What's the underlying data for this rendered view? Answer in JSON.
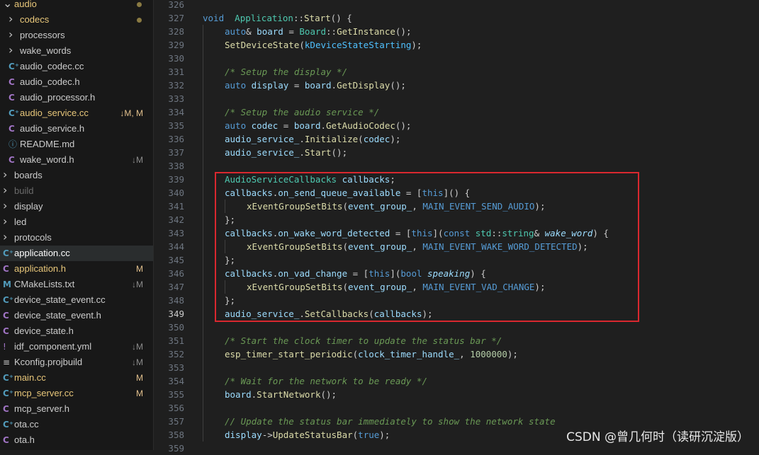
{
  "sidebar": {
    "items": [
      {
        "icon": "chevron-down",
        "name": "audio",
        "depth": 0,
        "color": "#e8c77a",
        "status": "",
        "dot": true
      },
      {
        "icon": "chevron-right",
        "name": "codecs",
        "depth": 1,
        "color": "#e8c77a",
        "status": "",
        "dot": true
      },
      {
        "icon": "chevron-right",
        "name": "processors",
        "depth": 1,
        "color": "#cccccc",
        "status": ""
      },
      {
        "icon": "chevron-right",
        "name": "wake_words",
        "depth": 1,
        "color": "#cccccc",
        "status": ""
      },
      {
        "icon": "cpp-file",
        "name": "audio_codec.cc",
        "depth": 1,
        "color": "#cccccc",
        "status": ""
      },
      {
        "icon": "c-file",
        "name": "audio_codec.h",
        "depth": 1,
        "color": "#cccccc",
        "status": ""
      },
      {
        "icon": "c-file",
        "name": "audio_processor.h",
        "depth": 1,
        "color": "#cccccc",
        "status": ""
      },
      {
        "icon": "cpp-file",
        "name": "audio_service.cc",
        "depth": 1,
        "color": "#e8c77a",
        "status": "↓M, M",
        "statusColor": "#e2c08d"
      },
      {
        "icon": "c-file",
        "name": "audio_service.h",
        "depth": 1,
        "color": "#cccccc",
        "status": ""
      },
      {
        "icon": "info-file",
        "name": "README.md",
        "depth": 1,
        "color": "#cccccc",
        "status": ""
      },
      {
        "icon": "c-file",
        "name": "wake_word.h",
        "depth": 1,
        "color": "#cccccc",
        "status": "↓M",
        "statusColor": "#8b8b8b"
      },
      {
        "icon": "chevron-right",
        "name": "boards",
        "depth": 0,
        "color": "#cccccc",
        "status": ""
      },
      {
        "icon": "chevron-right",
        "name": "build",
        "depth": 0,
        "color": "#6b6b6b",
        "status": ""
      },
      {
        "icon": "chevron-right",
        "name": "display",
        "depth": 0,
        "color": "#cccccc",
        "status": ""
      },
      {
        "icon": "chevron-right",
        "name": "led",
        "depth": 0,
        "color": "#cccccc",
        "status": ""
      },
      {
        "icon": "chevron-right",
        "name": "protocols",
        "depth": 0,
        "color": "#cccccc",
        "status": ""
      },
      {
        "icon": "cpp-file",
        "name": "application.cc",
        "depth": 0,
        "color": "#ffffff",
        "status": "",
        "selected": true
      },
      {
        "icon": "c-file",
        "name": "application.h",
        "depth": 0,
        "color": "#e8c77a",
        "status": "M",
        "statusColor": "#e2c08d"
      },
      {
        "icon": "m-file",
        "name": "CMakeLists.txt",
        "depth": 0,
        "color": "#cccccc",
        "status": "↓M",
        "statusColor": "#8b8b8b"
      },
      {
        "icon": "cpp-file",
        "name": "device_state_event.cc",
        "depth": 0,
        "color": "#cccccc",
        "status": ""
      },
      {
        "icon": "c-file",
        "name": "device_state_event.h",
        "depth": 0,
        "color": "#cccccc",
        "status": ""
      },
      {
        "icon": "c-file",
        "name": "device_state.h",
        "depth": 0,
        "color": "#cccccc",
        "status": ""
      },
      {
        "icon": "yml-file",
        "name": "idf_component.yml",
        "depth": 0,
        "color": "#cccccc",
        "status": "↓M",
        "statusColor": "#8b8b8b"
      },
      {
        "icon": "lines-file",
        "name": "Kconfig.projbuild",
        "depth": 0,
        "color": "#cccccc",
        "status": "↓M",
        "statusColor": "#8b8b8b"
      },
      {
        "icon": "cpp-file",
        "name": "main.cc",
        "depth": 0,
        "color": "#e8c77a",
        "status": "M",
        "statusColor": "#e2c08d"
      },
      {
        "icon": "cpp-file",
        "name": "mcp_server.cc",
        "depth": 0,
        "color": "#e8c77a",
        "status": "M",
        "statusColor": "#e2c08d"
      },
      {
        "icon": "c-file",
        "name": "mcp_server.h",
        "depth": 0,
        "color": "#cccccc",
        "status": ""
      },
      {
        "icon": "cpp-file",
        "name": "ota.cc",
        "depth": 0,
        "color": "#cccccc",
        "status": ""
      },
      {
        "icon": "c-file",
        "name": "ota.h",
        "depth": 0,
        "color": "#cccccc",
        "status": ""
      }
    ]
  },
  "editor": {
    "current_line": "349",
    "lines": [
      {
        "n": "326",
        "indent": 0,
        "t": []
      },
      {
        "n": "327",
        "indent": 0,
        "t": [
          [
            "kw",
            "void"
          ],
          [
            "",
            "  "
          ],
          [
            "ty",
            "Application"
          ],
          [
            "",
            "::"
          ],
          [
            "fn",
            "Start"
          ],
          [
            "",
            "() {"
          ]
        ]
      },
      {
        "n": "328",
        "indent": 1,
        "t": [
          [
            "kw",
            "auto"
          ],
          [
            "",
            "& "
          ],
          [
            "vr",
            "board"
          ],
          [
            "",
            " = "
          ],
          [
            "ty",
            "Board"
          ],
          [
            "",
            "::"
          ],
          [
            "fn",
            "GetInstance"
          ],
          [
            "",
            "();"
          ]
        ]
      },
      {
        "n": "329",
        "indent": 1,
        "t": [
          [
            "fn",
            "SetDeviceState"
          ],
          [
            "",
            "("
          ],
          [
            "ct",
            "kDeviceStateStarting"
          ],
          [
            "",
            ");"
          ]
        ]
      },
      {
        "n": "330",
        "indent": 1,
        "t": []
      },
      {
        "n": "331",
        "indent": 1,
        "t": [
          [
            "cm",
            "/* Setup the display */"
          ]
        ]
      },
      {
        "n": "332",
        "indent": 1,
        "t": [
          [
            "kw",
            "auto"
          ],
          [
            "",
            " "
          ],
          [
            "vr",
            "display"
          ],
          [
            "",
            " = "
          ],
          [
            "vr",
            "board"
          ],
          [
            "",
            "."
          ],
          [
            "fn",
            "GetDisplay"
          ],
          [
            "",
            "();"
          ]
        ]
      },
      {
        "n": "333",
        "indent": 1,
        "t": []
      },
      {
        "n": "334",
        "indent": 1,
        "t": [
          [
            "cm",
            "/* Setup the audio service */"
          ]
        ]
      },
      {
        "n": "335",
        "indent": 1,
        "t": [
          [
            "kw",
            "auto"
          ],
          [
            "",
            " "
          ],
          [
            "vr",
            "codec"
          ],
          [
            "",
            " = "
          ],
          [
            "vr",
            "board"
          ],
          [
            "",
            "."
          ],
          [
            "fn",
            "GetAudioCodec"
          ],
          [
            "",
            "();"
          ]
        ]
      },
      {
        "n": "336",
        "indent": 1,
        "t": [
          [
            "vr",
            "audio_service_"
          ],
          [
            "",
            "."
          ],
          [
            "fn",
            "Initialize"
          ],
          [
            "",
            "("
          ],
          [
            "vr",
            "codec"
          ],
          [
            "",
            ");"
          ]
        ]
      },
      {
        "n": "337",
        "indent": 1,
        "t": [
          [
            "vr",
            "audio_service_"
          ],
          [
            "",
            "."
          ],
          [
            "fn",
            "Start"
          ],
          [
            "",
            "();"
          ]
        ]
      },
      {
        "n": "338",
        "indent": 1,
        "t": []
      },
      {
        "n": "339",
        "indent": 1,
        "t": [
          [
            "ty",
            "AudioServiceCallbacks"
          ],
          [
            "",
            " "
          ],
          [
            "vr",
            "callbacks"
          ],
          [
            "",
            ";"
          ]
        ]
      },
      {
        "n": "340",
        "indent": 1,
        "t": [
          [
            "vr",
            "callbacks"
          ],
          [
            "",
            "."
          ],
          [
            "vr",
            "on_send_queue_available"
          ],
          [
            "",
            " = ["
          ],
          [
            "kw",
            "this"
          ],
          [
            "",
            "]() {"
          ]
        ]
      },
      {
        "n": "341",
        "indent": 2,
        "t": [
          [
            "fn",
            "xEventGroupSetBits"
          ],
          [
            "",
            "("
          ],
          [
            "vr",
            "event_group_"
          ],
          [
            "",
            ", "
          ],
          [
            "mac",
            "MAIN_EVENT_SEND_AUDIO"
          ],
          [
            "",
            ");"
          ]
        ]
      },
      {
        "n": "342",
        "indent": 1,
        "t": [
          [
            "",
            "};"
          ]
        ]
      },
      {
        "n": "343",
        "indent": 1,
        "t": [
          [
            "vr",
            "callbacks"
          ],
          [
            "",
            "."
          ],
          [
            "vr",
            "on_wake_word_detected"
          ],
          [
            "",
            " = ["
          ],
          [
            "kw",
            "this"
          ],
          [
            "",
            "]("
          ],
          [
            "kw",
            "const"
          ],
          [
            "",
            " "
          ],
          [
            "ty",
            "std"
          ],
          [
            "",
            "::"
          ],
          [
            "ty",
            "string"
          ],
          [
            "",
            "& "
          ],
          [
            "vr it",
            "wake_word"
          ],
          [
            "",
            ") {"
          ]
        ]
      },
      {
        "n": "344",
        "indent": 2,
        "t": [
          [
            "fn",
            "xEventGroupSetBits"
          ],
          [
            "",
            "("
          ],
          [
            "vr",
            "event_group_"
          ],
          [
            "",
            ", "
          ],
          [
            "mac",
            "MAIN_EVENT_WAKE_WORD_DETECTED"
          ],
          [
            "",
            ");"
          ]
        ]
      },
      {
        "n": "345",
        "indent": 1,
        "t": [
          [
            "",
            "};"
          ]
        ]
      },
      {
        "n": "346",
        "indent": 1,
        "t": [
          [
            "vr",
            "callbacks"
          ],
          [
            "",
            "."
          ],
          [
            "vr",
            "on_vad_change"
          ],
          [
            "",
            " = ["
          ],
          [
            "kw",
            "this"
          ],
          [
            "",
            "]("
          ],
          [
            "kw",
            "bool"
          ],
          [
            "",
            " "
          ],
          [
            "vr it",
            "speaking"
          ],
          [
            "",
            ") {"
          ]
        ]
      },
      {
        "n": "347",
        "indent": 2,
        "t": [
          [
            "fn",
            "xEventGroupSetBits"
          ],
          [
            "",
            "("
          ],
          [
            "vr",
            "event_group_"
          ],
          [
            "",
            ", "
          ],
          [
            "mac",
            "MAIN_EVENT_VAD_CHANGE"
          ],
          [
            "",
            ");"
          ]
        ]
      },
      {
        "n": "348",
        "indent": 1,
        "t": [
          [
            "",
            "};"
          ]
        ]
      },
      {
        "n": "349",
        "indent": 1,
        "t": [
          [
            "vr",
            "audio_service_"
          ],
          [
            "",
            "."
          ],
          [
            "fn",
            "SetCallbacks"
          ],
          [
            "",
            "("
          ],
          [
            "vr",
            "callbacks"
          ],
          [
            "",
            ");"
          ]
        ]
      },
      {
        "n": "350",
        "indent": 1,
        "t": []
      },
      {
        "n": "351",
        "indent": 1,
        "t": [
          [
            "cm",
            "/* Start the clock timer to update the status bar */"
          ]
        ]
      },
      {
        "n": "352",
        "indent": 1,
        "t": [
          [
            "fn",
            "esp_timer_start_periodic"
          ],
          [
            "",
            "("
          ],
          [
            "vr",
            "clock_timer_handle_"
          ],
          [
            "",
            ", "
          ],
          [
            "nu",
            "1000000"
          ],
          [
            "",
            ");"
          ]
        ]
      },
      {
        "n": "353",
        "indent": 1,
        "t": []
      },
      {
        "n": "354",
        "indent": 1,
        "t": [
          [
            "cm",
            "/* Wait for the network to be ready */"
          ]
        ]
      },
      {
        "n": "355",
        "indent": 1,
        "t": [
          [
            "vr",
            "board"
          ],
          [
            "",
            "."
          ],
          [
            "fn",
            "StartNetwork"
          ],
          [
            "",
            "();"
          ]
        ]
      },
      {
        "n": "356",
        "indent": 1,
        "t": []
      },
      {
        "n": "357",
        "indent": 1,
        "t": [
          [
            "cm",
            "// Update the status bar immediately to show the network state"
          ]
        ]
      },
      {
        "n": "358",
        "indent": 1,
        "t": [
          [
            "vr",
            "display"
          ],
          [
            "",
            "->"
          ],
          [
            "fn",
            "UpdateStatusBar"
          ],
          [
            "",
            "("
          ],
          [
            "kw",
            "true"
          ],
          [
            "",
            ");"
          ]
        ]
      },
      {
        "n": "359",
        "indent": 0,
        "t": []
      }
    ]
  },
  "watermark": "CSDN @曾几何时（读研沉淀版）"
}
